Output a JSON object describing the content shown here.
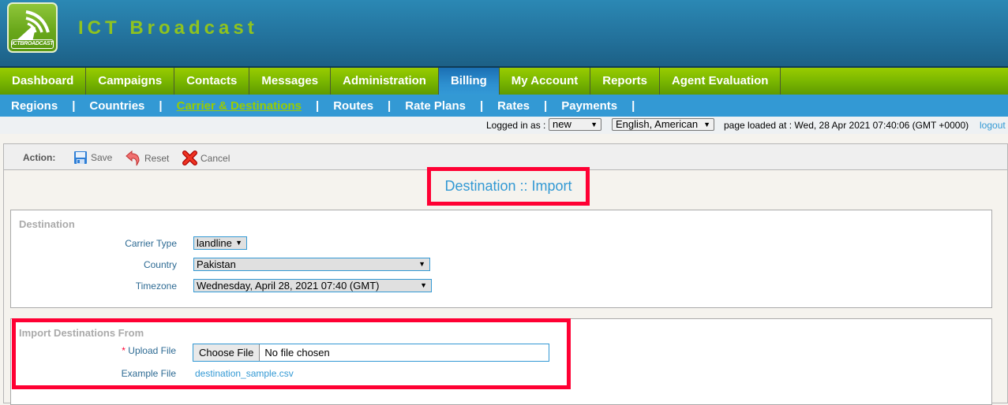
{
  "brand": {
    "title": "ICT Broadcast",
    "logo_tag": "ICTBROADCAST",
    "accent_color": "#8fc31f"
  },
  "main_nav": {
    "tabs": [
      {
        "label": "Dashboard",
        "active": false
      },
      {
        "label": "Campaigns",
        "active": false
      },
      {
        "label": "Contacts",
        "active": false
      },
      {
        "label": "Messages",
        "active": false
      },
      {
        "label": "Administration",
        "active": false
      },
      {
        "label": "Billing",
        "active": true
      },
      {
        "label": "My Account",
        "active": false
      },
      {
        "label": "Reports",
        "active": false
      },
      {
        "label": "Agent Evaluation",
        "active": false
      }
    ]
  },
  "sub_nav": {
    "items": [
      {
        "label": "Regions",
        "active": false
      },
      {
        "label": "Countries",
        "active": false
      },
      {
        "label": "Carrier & Destinations ",
        "active": true
      },
      {
        "label": "Routes",
        "active": false
      },
      {
        "label": "Rate Plans",
        "active": false
      },
      {
        "label": "Rates",
        "active": false
      },
      {
        "label": "Payments",
        "active": false
      }
    ],
    "separator": "|"
  },
  "status_bar": {
    "logged_in_label": "Logged in as :",
    "user": "new",
    "language": "English, American",
    "page_loaded": "page loaded at : Wed, 28 Apr 2021 07:40:06 (GMT +0000)",
    "logout": "logout"
  },
  "action_bar": {
    "label": "Action:",
    "save": "Save",
    "reset": "Reset",
    "cancel": "Cancel"
  },
  "page_heading": "Destination :: Import",
  "destination": {
    "title": "Destination",
    "carrier_type_label": "Carrier Type",
    "carrier_type_value": "landline",
    "country_label": "Country",
    "country_value": "Pakistan",
    "timezone_label": "Timezone",
    "timezone_value": "Wednesday, April 28, 2021 07:40 (GMT)"
  },
  "import": {
    "title": "Import Destinations From",
    "required_mark": "*",
    "upload_label": "Upload File",
    "choose_file": "Choose File",
    "file_status": "No file chosen",
    "example_label": "Example File",
    "example_link": "destination_sample.csv"
  },
  "icons": {
    "dropdown": "▼"
  },
  "colors": {
    "highlight": "#ff0033",
    "link": "#3399d4",
    "nav_green": "#7ab700",
    "nav_blue": "#3399d4"
  }
}
